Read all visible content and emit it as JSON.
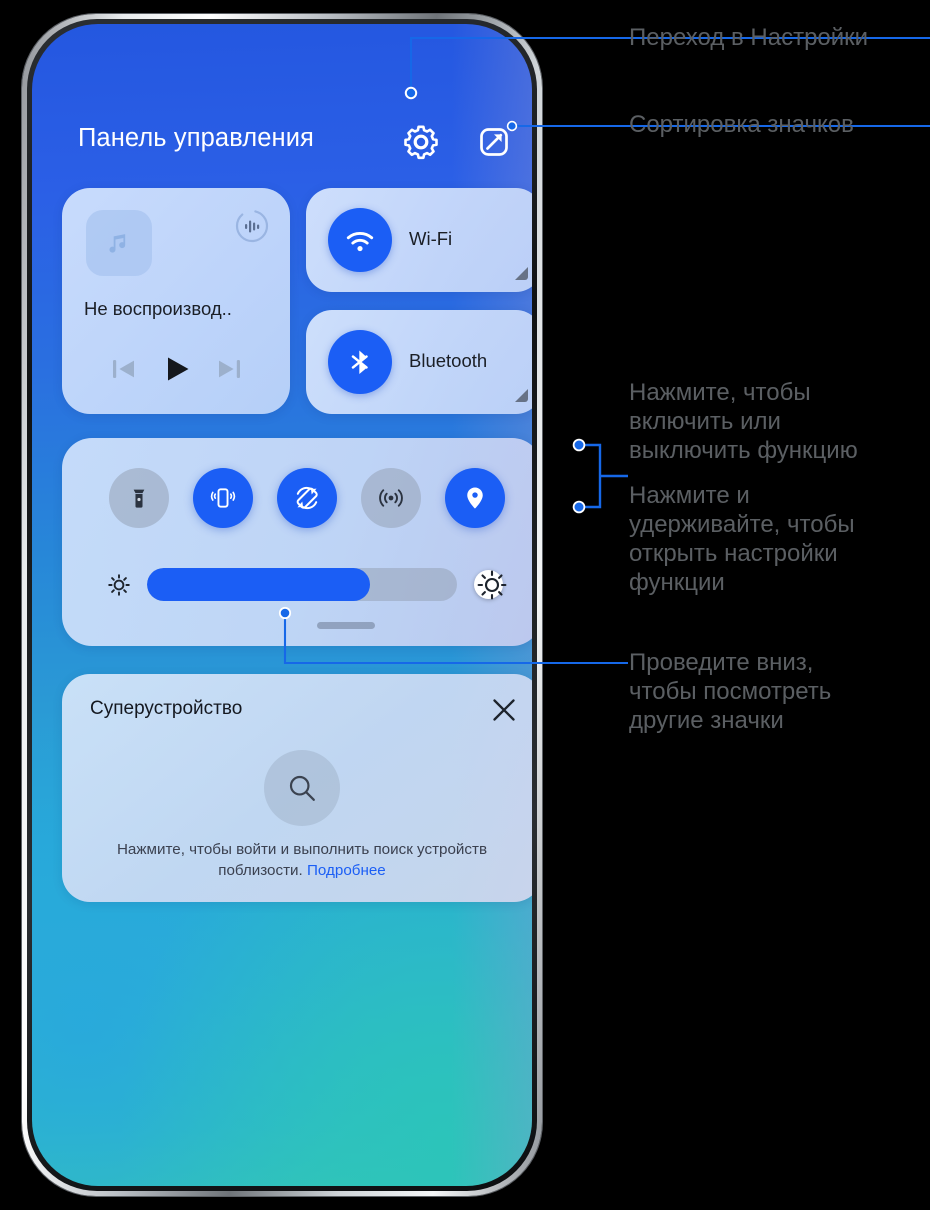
{
  "panel": {
    "title": "Панель управления",
    "gear_icon": "gear-icon",
    "edit_icon": "edit-icon"
  },
  "media": {
    "title": "Не воспроизвод..",
    "album_icon": "music-note-icon",
    "cast_icon": "audio-cast-icon",
    "prev_label": "prev-track",
    "play_label": "play",
    "next_label": "next-track"
  },
  "tiles": [
    {
      "label": "Wi-Fi",
      "icon": "wifi-icon",
      "state": "on"
    },
    {
      "label": "Bluetooth",
      "icon": "bluetooth-icon",
      "state": "on"
    }
  ],
  "toggles": [
    {
      "name": "flashlight",
      "icon": "flashlight-icon",
      "state": "off"
    },
    {
      "name": "vibrate",
      "icon": "vibrate-icon",
      "state": "on"
    },
    {
      "name": "auto-rotate",
      "icon": "auto-rotate-icon",
      "state": "on"
    },
    {
      "name": "hotspot",
      "icon": "hotspot-icon",
      "state": "off"
    },
    {
      "name": "location",
      "icon": "location-pin-icon",
      "state": "on"
    }
  ],
  "brightness": {
    "value_percent": 72,
    "low_icon": "brightness-low-icon",
    "high_icon": "brightness-high-icon"
  },
  "super_device": {
    "title": "Суперустройство",
    "close_icon": "close-icon",
    "search_icon": "search-icon",
    "description": "Нажмите, чтобы войти и выполнить поиск устройств поблизости. ",
    "link": "Подробнее"
  },
  "annotations": {
    "settings": "Переход в Настройки",
    "sort": "Сортировка значков",
    "tap_toggle": "Нажмите, чтобы\nвключить или\nвыключить функцию",
    "press_hold": "Нажмите и\nудерживайте, чтобы\nоткрыть настройки\nфункции",
    "swipe_down": "Проведите вниз,\nчтобы посмотреть\nдругие значки"
  },
  "colors": {
    "accent": "#1b5ef5",
    "connector": "#1668e8",
    "annotation_text": "#5b5f63",
    "panel_title": "#ffffff"
  }
}
